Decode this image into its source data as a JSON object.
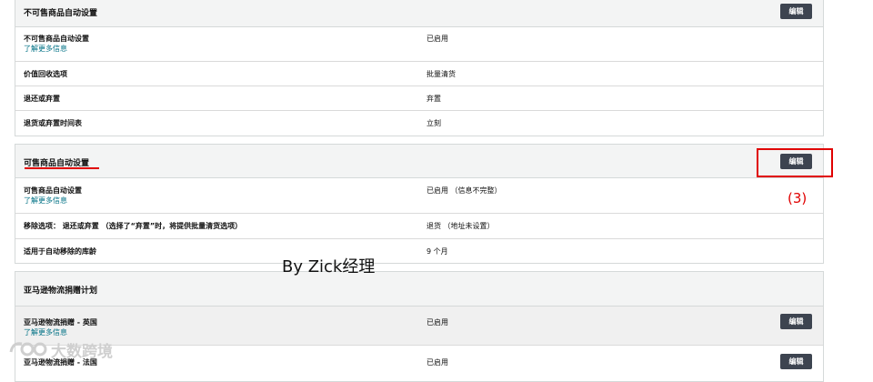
{
  "unsellable": {
    "title": "不可售商品自动设置",
    "edit_label": "编辑",
    "rows": [
      {
        "label": "不可售商品自动设置",
        "link": "了解更多信息",
        "value": "已启用"
      },
      {
        "label": "价值回收选项",
        "value": "批量清货"
      },
      {
        "label": "退还或弃置",
        "value": "弃置"
      },
      {
        "label": "退货或弃置时间表",
        "value": "立刻"
      }
    ]
  },
  "sellable": {
    "title": "可售商品自动设置",
    "edit_label": "编辑",
    "rows": [
      {
        "label": "可售商品自动设置",
        "link": "了解更多信息",
        "value": "已启用 （信息不完整）"
      },
      {
        "label": "移除选项： 退还或弃置 （选择了“弃置”时，将提供批量清货选项）",
        "value": "退货 （地址未设置）"
      },
      {
        "label": "适用于自动移除的库龄",
        "value": "9 个月"
      }
    ]
  },
  "donation": {
    "title": "亚马逊物流捐赠计划",
    "rows": [
      {
        "label": "亚马逊物流捐赠 - 英国",
        "link": "了解更多信息",
        "value": "已启用",
        "edit_label": "编辑"
      },
      {
        "label": "亚马逊物流捐赠 - 法国",
        "value": "已启用",
        "edit_label": "编辑"
      }
    ]
  },
  "annotation": {
    "step": "(3)",
    "author": "By Zick经理",
    "watermark": "大数跨境"
  },
  "colors": {
    "highlight": "#e00000",
    "button": "#3d4450",
    "link": "#007185"
  }
}
